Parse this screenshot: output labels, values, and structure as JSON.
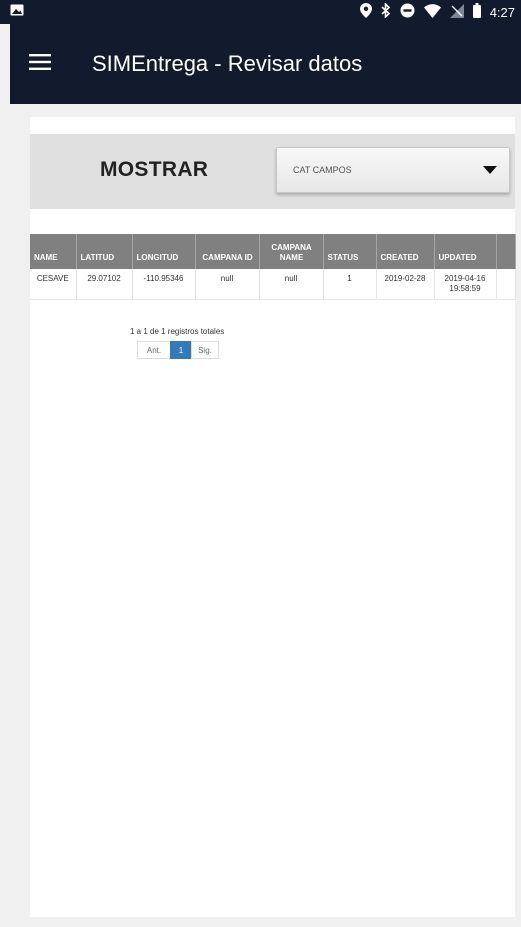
{
  "status_bar": {
    "time": "4:27",
    "icons": [
      "image-icon",
      "location-icon",
      "bluetooth-icon",
      "do-not-disturb-icon",
      "wifi-icon",
      "no-signal-icon",
      "battery-icon"
    ]
  },
  "app_bar": {
    "title": "SIMEntrega - Revisar datos",
    "color": "#121a2e"
  },
  "filter": {
    "label": "MOSTRAR",
    "selected": "CAT CAMPOS"
  },
  "table": {
    "headers": [
      "NAME",
      "LATITUD",
      "LONGITUD",
      "CAMPANA ID",
      "CAMPANA NAME",
      "STATUS",
      "CREATED",
      "UPDATED",
      ""
    ],
    "rows": [
      [
        "CESAVE",
        "29.07102",
        "-110.95346",
        "null",
        "null",
        "1",
        "2019-02-28",
        "2019-04-16 19:58:59",
        ""
      ]
    ]
  },
  "pagination": {
    "info": "1 a 1 de 1 registros totales",
    "prev": "Ant.",
    "current": "1",
    "next": "Sig.",
    "accent": "#337ab7"
  }
}
